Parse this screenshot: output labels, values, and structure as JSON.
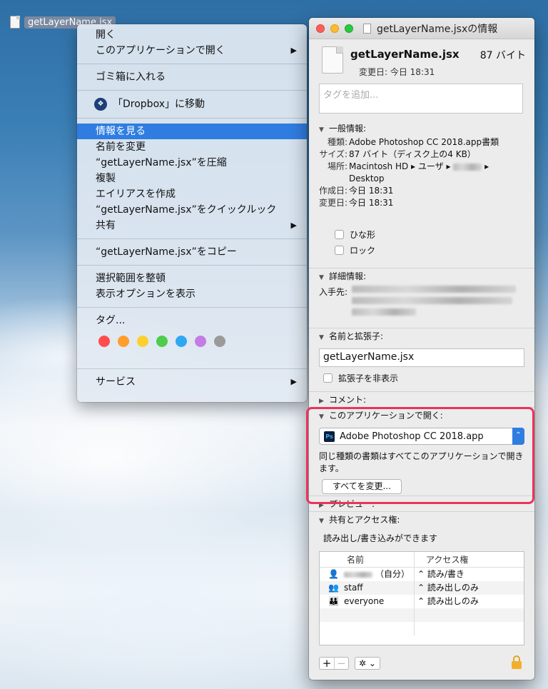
{
  "desktop": {
    "file_name": "getLayerName.jsx"
  },
  "menu": {
    "open": "開く",
    "open_with": "このアプリケーションで開く",
    "trash": "ゴミ箱に入れる",
    "dropbox": "「Dropbox」に移動",
    "get_info": "情報を見る",
    "rename": "名前を変更",
    "compress": "“getLayerName.jsx”を圧縮",
    "duplicate": "複製",
    "make_alias": "エイリアスを作成",
    "quick_look": "“getLayerName.jsx”をクイックルック",
    "share": "共有",
    "copy": "“getLayerName.jsx”をコピー",
    "clean_up": "選択範囲を整頓",
    "view_options": "表示オプションを表示",
    "tags": "タグ...",
    "tag_colors": [
      "#ff4d4d",
      "#ff9e2c",
      "#fcd02f",
      "#4ccd4c",
      "#2fa8f2",
      "#c47ce6",
      "#9a9a9a"
    ],
    "services": "サービス"
  },
  "info": {
    "window_title": "getLayerName.jsxの情報",
    "file_name": "getLayerName.jsx",
    "file_size": "87 バイト",
    "modified": "変更日: 今日 18:31",
    "tag_placeholder": "タグを追加...",
    "general": {
      "header": "一般情報:",
      "kind_label": "種類:",
      "kind_value": "Adobe Photoshop CC 2018.app書類",
      "size_label": "サイズ:",
      "size_value": "87 バイト（ディスク上の4 KB）",
      "where_label": "場所:",
      "where_value_1": "Macintosh HD ▸ ユーザ ▸",
      "where_value_2": "Desktop",
      "created_label": "作成日:",
      "created_value": "今日 18:31",
      "modified_label": "変更日:",
      "modified_value": "今日 18:31",
      "stationery": "ひな形",
      "locked": "ロック"
    },
    "more_info": {
      "header": "詳細情報:",
      "source_label": "入手先:"
    },
    "name_ext": {
      "header": "名前と拡張子:",
      "value": "getLayerName.jsx",
      "hide_ext": "拡張子を非表示"
    },
    "comments": {
      "header": "コメント:"
    },
    "open_with": {
      "header": "このアプリケーションで開く:",
      "app": "Adobe Photoshop CC 2018.app",
      "app_icon": "Ps",
      "note": "同じ種類の書類はすべてこのアプリケーションで開きます。",
      "change_all": "すべてを変更..."
    },
    "preview": {
      "header": "プレビュー:"
    },
    "sharing": {
      "header": "共有とアクセス権:",
      "summary": "読み出し/書き込みができます",
      "col_name": "名前",
      "col_priv": "アクセス権",
      "rows": [
        {
          "name": "（自分）",
          "priv": "⌃ 読み/書き"
        },
        {
          "name": "staff",
          "priv": "⌃ 読み出しのみ"
        },
        {
          "name": "everyone",
          "priv": "⌃ 読み出しのみ"
        }
      ]
    }
  }
}
